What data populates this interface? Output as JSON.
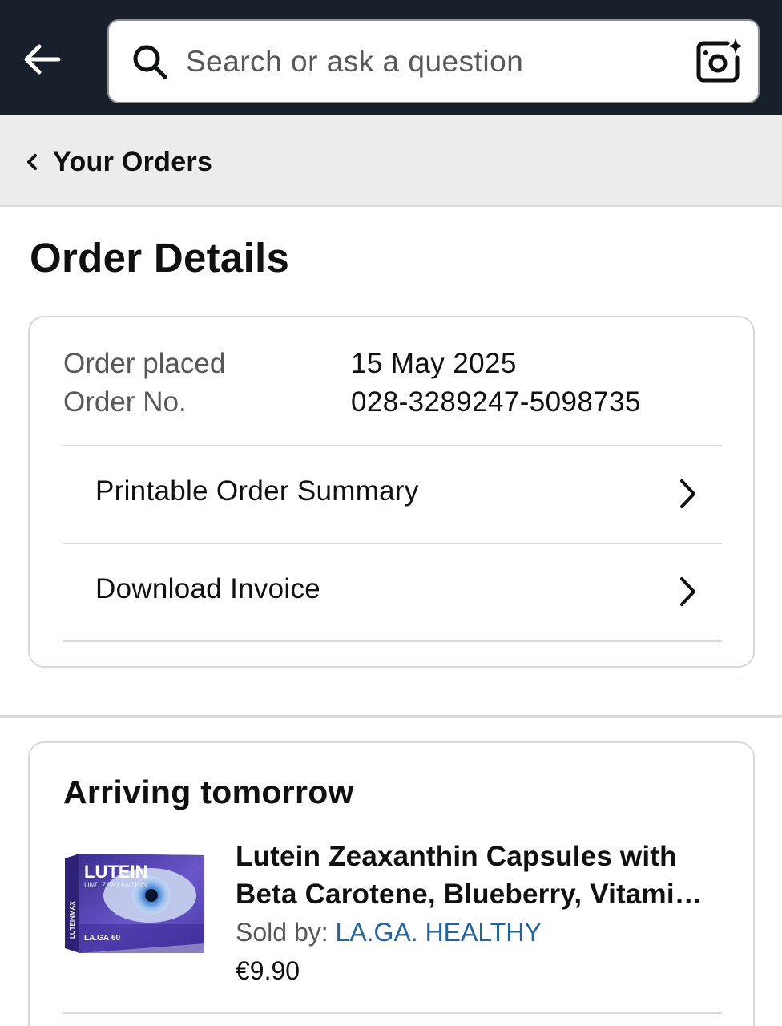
{
  "header": {
    "search_placeholder": "Search or ask a question",
    "icons": {
      "back": "back-arrow-icon",
      "search": "search-icon",
      "camera": "camera-sparkle-icon"
    }
  },
  "breadcrumb": {
    "label": "Your Orders"
  },
  "page": {
    "title": "Order Details"
  },
  "order": {
    "placed_label": "Order placed",
    "placed_value": "15 May 2025",
    "number_label": "Order No.",
    "number_value": "028-3289247-5098735",
    "links": [
      {
        "label": "Printable Order Summary"
      },
      {
        "label": "Download Invoice"
      }
    ]
  },
  "shipment": {
    "status": "Arriving tomorrow",
    "item": {
      "title_line1": "Lutein Zeaxanthin Capsules with",
      "title_line2": "Beta Carotene, Blueberry, Vitamin A and Zinc",
      "sold_by_label": "Sold by: ",
      "seller": "LA.GA. HEALTHY",
      "price": "€9.90",
      "image_text": {
        "brand": "LUTEIN",
        "sub": "UND ZEAXANTHIN",
        "side": "LUTEINMAX",
        "maker": "LA.GA",
        "count": "60"
      }
    }
  },
  "colors": {
    "topbar": "#17202b",
    "link": "#2162a1",
    "muted_text": "#565959",
    "border": "#d5d9d9"
  }
}
